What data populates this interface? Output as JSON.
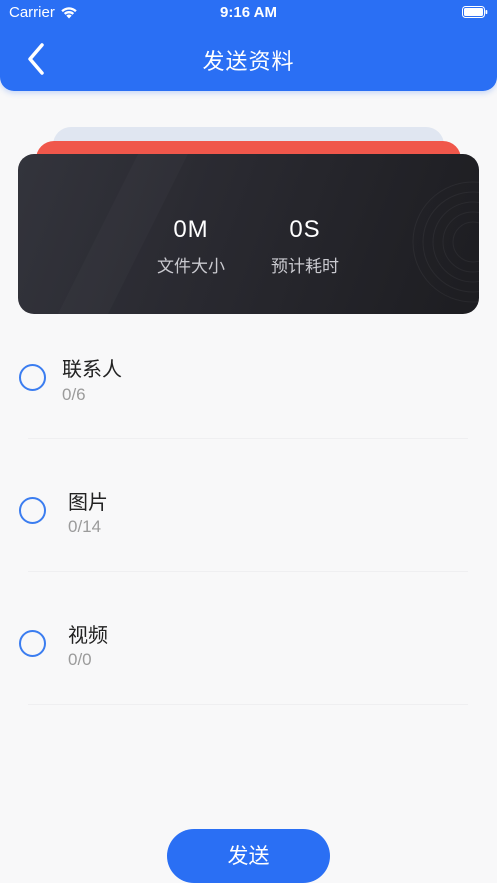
{
  "status_bar": {
    "carrier": "Carrier",
    "time": "9:16 AM"
  },
  "nav": {
    "title": "发送资料",
    "back_icon": "chevron-left-icon"
  },
  "summary_card": {
    "file_size_value": "0M",
    "file_size_label": "文件大小",
    "eta_value": "0S",
    "eta_label": "预计耗时"
  },
  "items": [
    {
      "label": "联系人",
      "count": "0/6",
      "selected": false
    },
    {
      "label": "图片",
      "count": "0/14",
      "selected": false
    },
    {
      "label": "视频",
      "count": "0/0",
      "selected": false
    }
  ],
  "send_button": {
    "label": "发送"
  },
  "colors": {
    "primary": "#2a6ff4",
    "accent_red": "#f0574b",
    "card_dark": "#2a2a31",
    "radio_blue": "#3b7df0"
  }
}
